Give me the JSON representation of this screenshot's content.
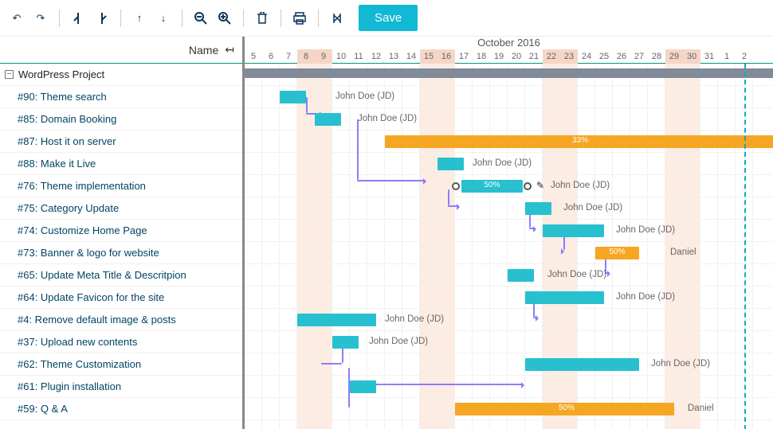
{
  "toolbar": {
    "save_label": "Save",
    "buttons": [
      "undo",
      "redo",
      "outdent",
      "indent",
      "move-up",
      "move-down",
      "zoom-out",
      "zoom-in",
      "delete",
      "print",
      "expand-collapse"
    ]
  },
  "left": {
    "header": "Name",
    "root": "WordPress Project",
    "tasks": [
      "#90: Theme search",
      "#85: Domain Booking",
      "#87: Host it on server",
      "#88: Make it Live",
      "#76: Theme implementation",
      "#75: Category Update",
      "#74: Customize Home Page",
      "#73: Banner & logo for website",
      "#65: Update Meta Title & Descritpion",
      "#64: Update Favicon for the site",
      "#4: Remove default image & posts",
      "#37: Upload new contents",
      "#62: Theme Customization",
      "#61: Plugin installation",
      "#59: Q & A"
    ]
  },
  "timeline": {
    "month": "October 2016",
    "start_day": 5,
    "days": [
      5,
      6,
      7,
      8,
      9,
      10,
      11,
      12,
      13,
      14,
      15,
      16,
      17,
      18,
      19,
      20,
      21,
      22,
      23,
      24,
      25,
      26,
      27,
      28,
      29,
      30,
      31,
      1,
      2
    ],
    "weekend_days": [
      8,
      9,
      15,
      16,
      22,
      23,
      29,
      30
    ],
    "today": 2
  },
  "labels": {
    "jd": "John Doe (JD)",
    "daniel": "Daniel",
    "p33": "33%",
    "p50": "50%"
  },
  "chart_data": {
    "type": "gantt",
    "title": "WordPress Project",
    "x_unit": "day",
    "x_range": [
      "2016-10-05",
      "2016-11-02"
    ],
    "tasks": [
      {
        "id": "root",
        "name": "WordPress Project",
        "type": "summary",
        "start": "2016-10-05",
        "end": "2016-11-02"
      },
      {
        "id": 90,
        "name": "Theme search",
        "start": "2016-10-07",
        "end": "2016-10-08",
        "assignee": "John Doe (JD)"
      },
      {
        "id": 85,
        "name": "Domain Booking",
        "start": "2016-10-09",
        "end": "2016-10-10",
        "assignee": "John Doe (JD)",
        "depends_on": [
          90
        ]
      },
      {
        "id": 87,
        "name": "Host it on server",
        "start": "2016-10-13",
        "end": "2016-11-02",
        "progress": 33,
        "color": "orange",
        "depends_on": [
          85
        ]
      },
      {
        "id": 88,
        "name": "Make it Live",
        "start": "2016-10-16",
        "end": "2016-10-17",
        "assignee": "John Doe (JD)",
        "depends_on": [
          85
        ]
      },
      {
        "id": 76,
        "name": "Theme implementation",
        "start": "2016-10-17",
        "end": "2016-10-20",
        "progress": 50,
        "assignee": "John Doe (JD)",
        "depends_on": [
          88
        ],
        "selected": true
      },
      {
        "id": 75,
        "name": "Category Update",
        "start": "2016-10-21",
        "end": "2016-10-22",
        "assignee": "John Doe (JD)",
        "depends_on": [
          76
        ]
      },
      {
        "id": 74,
        "name": "Customize Home Page",
        "start": "2016-10-22",
        "end": "2016-10-25",
        "assignee": "John Doe (JD)",
        "depends_on": [
          75
        ]
      },
      {
        "id": 73,
        "name": "Banner & logo for website",
        "start": "2016-10-25",
        "end": "2016-10-27",
        "progress": 50,
        "assignee": "Daniel",
        "color": "orange",
        "depends_on": [
          74
        ]
      },
      {
        "id": 65,
        "name": "Update Meta Title & Descritpion",
        "start": "2016-10-20",
        "end": "2016-10-21",
        "assignee": "John Doe (JD)"
      },
      {
        "id": 64,
        "name": "Update Favicon for the site",
        "start": "2016-10-21",
        "end": "2016-10-25",
        "assignee": "John Doe (JD)",
        "depends_on": [
          65
        ]
      },
      {
        "id": 4,
        "name": "Remove default image & posts",
        "start": "2016-10-08",
        "end": "2016-10-12",
        "assignee": "John Doe (JD)"
      },
      {
        "id": 37,
        "name": "Upload new contents",
        "start": "2016-10-10",
        "end": "2016-10-11",
        "assignee": "John Doe (JD)",
        "depends_on": [
          4
        ]
      },
      {
        "id": 62,
        "name": "Theme Customization",
        "start": "2016-10-21",
        "end": "2016-10-27",
        "assignee": "John Doe (JD)",
        "depends_on": [
          37
        ]
      },
      {
        "id": 61,
        "name": "Plugin installation",
        "start": "2016-10-11",
        "end": "2016-10-12",
        "depends_on": [
          37
        ]
      },
      {
        "id": 59,
        "name": "Q & A",
        "start": "2016-10-17",
        "end": "2016-10-29",
        "progress": 50,
        "assignee": "Daniel",
        "color": "orange"
      }
    ]
  }
}
